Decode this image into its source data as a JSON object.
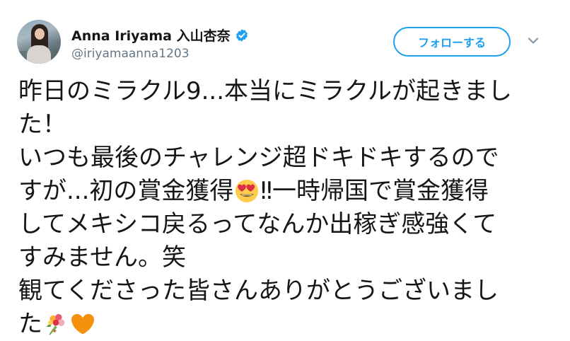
{
  "header": {
    "display_name": "Anna Iriyama 入山杏奈",
    "handle": "@iriyamaanna1203",
    "follow_label": "フォローする"
  },
  "icons": {
    "verified": "verified-badge-icon",
    "chevron": "chevron-down-icon",
    "emoji_1": "heart-eyes-emoji",
    "emoji_2": "bouquet-emoji",
    "emoji_3": "orange-heart-emoji"
  },
  "colors": {
    "accent": "#1da1f2",
    "secondary_text": "#657786",
    "primary_text": "#14171a"
  },
  "tweet": {
    "line1": "昨日のミラクル9...本当にミラクルが起きまし",
    "line2": "た！",
    "line3": "いつも最後のチャレンジ超ドキドキするので",
    "line4a": "すが...初の賞金獲得",
    "line4b": "‼︎一時帰国で賞金獲得",
    "line5": "してメキシコ戻るってなんか出稼ぎ感強くて",
    "line6": "すみません。笑",
    "line7": "観てくださった皆さんありがとうございまし",
    "line8": "た"
  }
}
